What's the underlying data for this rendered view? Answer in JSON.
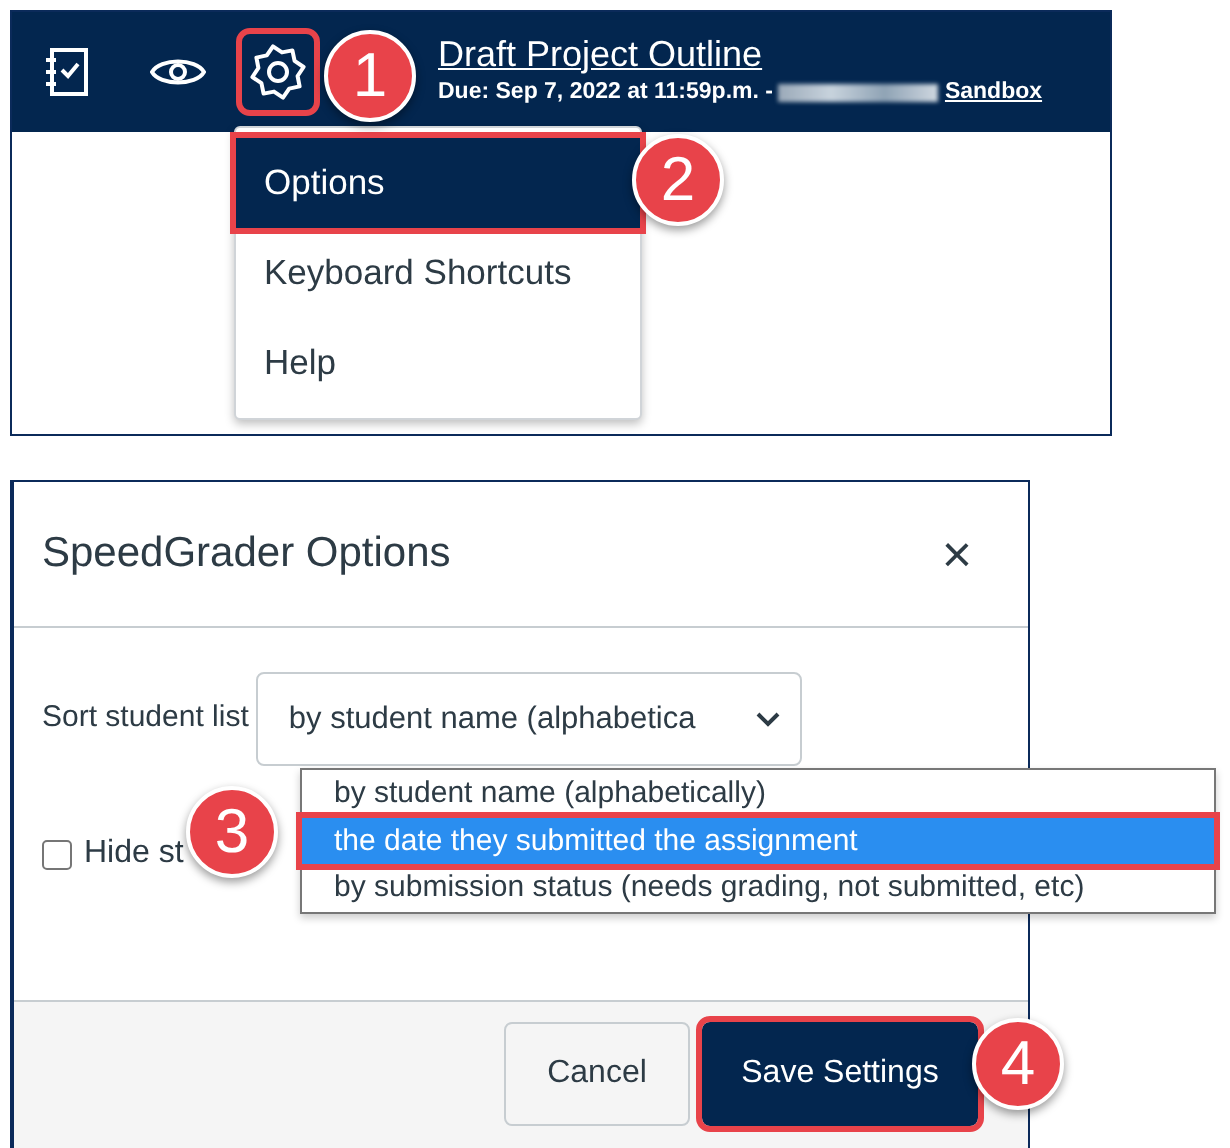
{
  "header": {
    "title": "Draft Project Outline",
    "due": "Due: Sep 7, 2022 at 11:59p.m. -",
    "course": "Sandbox",
    "gear_highlighted": true
  },
  "settings_menu": {
    "items": [
      {
        "label": "Options",
        "selected": true,
        "highlighted": true
      },
      {
        "label": "Keyboard Shortcuts",
        "selected": false,
        "highlighted": false
      },
      {
        "label": "Help",
        "selected": false,
        "highlighted": false
      }
    ]
  },
  "dialog": {
    "title": "SpeedGrader Options",
    "close": "×",
    "sort_label": "Sort student list",
    "sort_value": "by student name (alphabetica",
    "sort_options": [
      {
        "label": "by student name (alphabetically)",
        "selected": false,
        "highlighted": false
      },
      {
        "label": "the date they submitted the assignment",
        "selected": true,
        "highlighted": true
      },
      {
        "label": "by submission status (needs grading, not submitted, etc)",
        "selected": false,
        "highlighted": false
      }
    ],
    "hide_label": "Hide st",
    "hide_checked": false,
    "buttons": [
      {
        "label": "Cancel",
        "kind": "secondary",
        "highlighted": false
      },
      {
        "label": "Save Settings",
        "kind": "primary",
        "highlighted": true
      }
    ]
  },
  "callouts": [
    "1",
    "2",
    "3",
    "4"
  ]
}
